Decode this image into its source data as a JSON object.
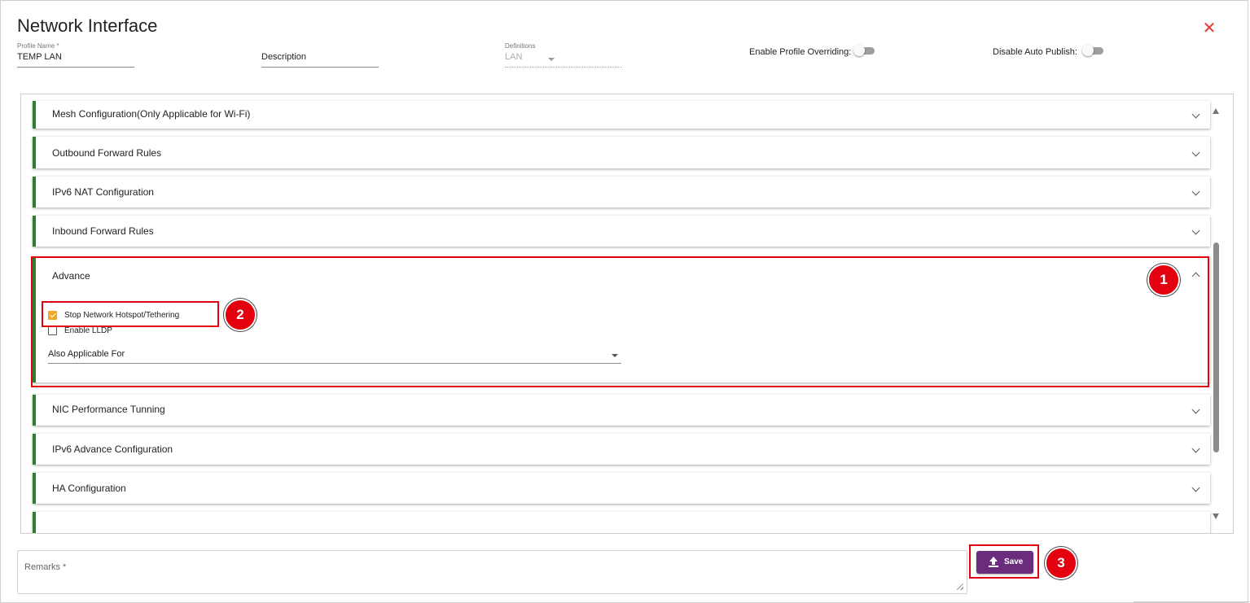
{
  "dialog": {
    "title": "Network Interface",
    "close_icon": "close-icon"
  },
  "form": {
    "profile_name": {
      "label": "Profile Name *",
      "value": "TEMP LAN"
    },
    "description": {
      "placeholder": "Description"
    },
    "definitions": {
      "label": "Definitions",
      "value": "LAN"
    },
    "enable_profile_overriding": {
      "label": "Enable Profile Overriding:",
      "on": false
    },
    "disable_auto_publish": {
      "label": "Disable Auto Publish:",
      "on": false
    }
  },
  "sections": [
    {
      "title": "Mesh Configuration(Only Applicable for Wi-Fi)",
      "expanded": false
    },
    {
      "title": "Outbound Forward Rules",
      "expanded": false
    },
    {
      "title": "IPv6 NAT Configuration",
      "expanded": false
    },
    {
      "title": "Inbound Forward Rules",
      "expanded": false
    },
    {
      "title": "Advance",
      "expanded": true
    },
    {
      "title": "NIC Performance Tunning",
      "expanded": false
    },
    {
      "title": "IPv6 Advance Configuration",
      "expanded": false
    },
    {
      "title": "HA Configuration",
      "expanded": false
    }
  ],
  "advance": {
    "stop_hotspot": {
      "label": "Stop Network Hotspot/Tethering",
      "checked": true
    },
    "enable_lldp": {
      "label": "Enable LLDP",
      "checked": false
    },
    "also_applicable_for": {
      "placeholder": "Also Applicable For"
    }
  },
  "remarks": {
    "label": "Remarks *"
  },
  "save_button": {
    "label": "Save"
  },
  "annotations": [
    "1",
    "2",
    "3"
  ],
  "colors": {
    "accent_green": "#2e7d32",
    "highlight_red": "#e3000f",
    "save_purple": "#6a2c7d",
    "checkbox_orange": "#f5a623"
  }
}
